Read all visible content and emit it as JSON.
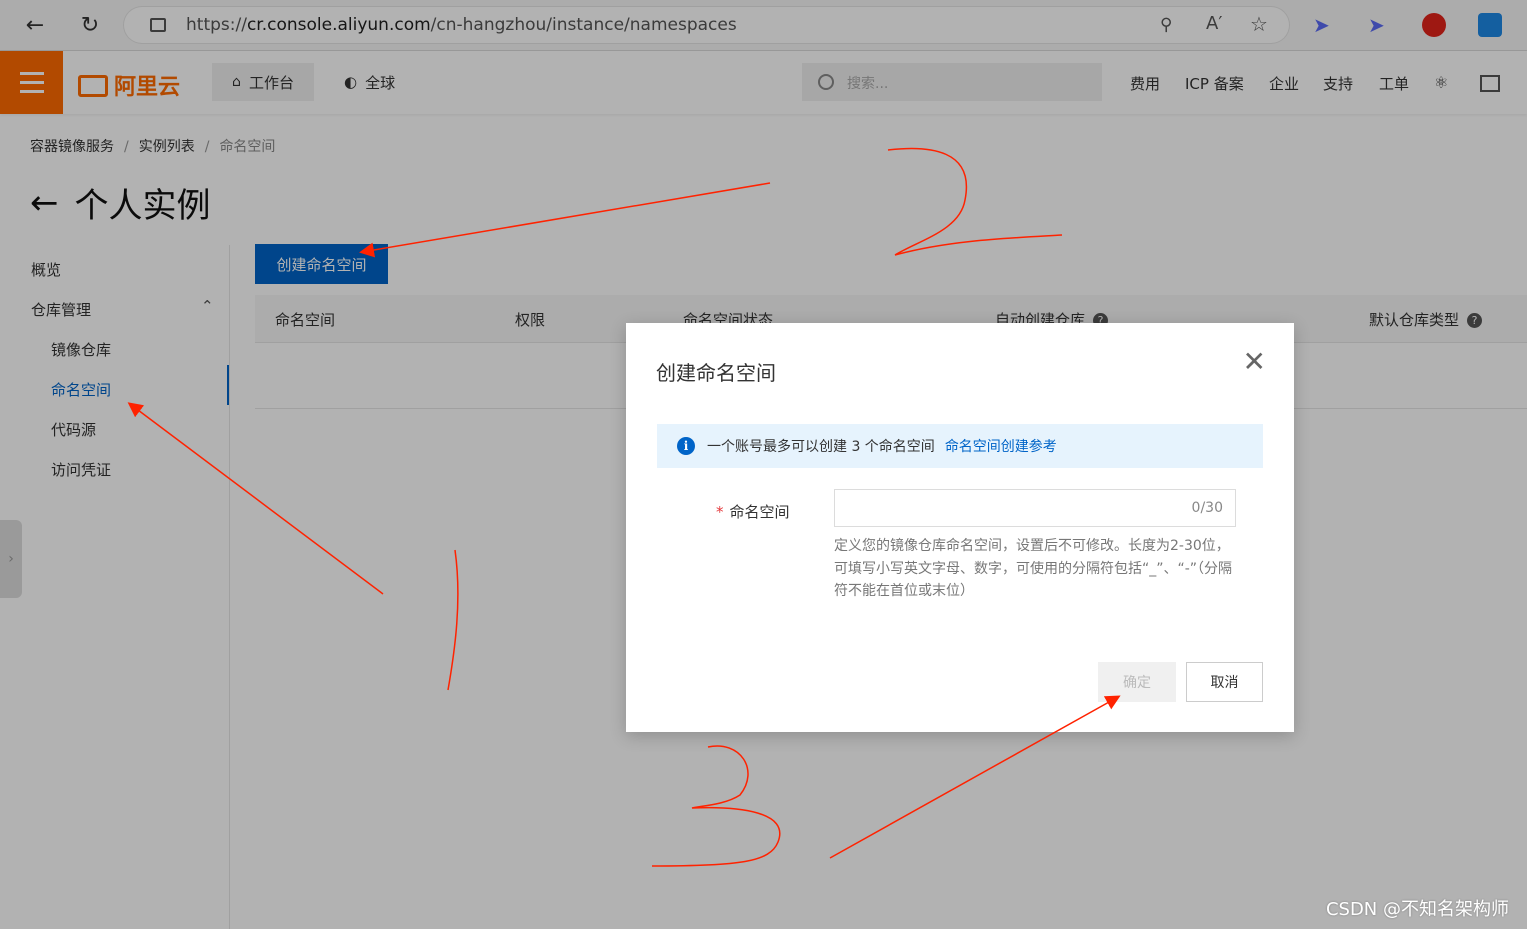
{
  "browser": {
    "url_prefix": "https://",
    "url_host": "cr.console.aliyun.com",
    "url_path": "/cn-hangzhou/instance/namespaces"
  },
  "header": {
    "logo": "阿里云",
    "workbench": "工作台",
    "region": "全球",
    "search_placeholder": "搜索...",
    "links": [
      "费用",
      "ICP 备案",
      "企业",
      "支持",
      "工单"
    ]
  },
  "breadcrumb": [
    "容器镜像服务",
    "实例列表",
    "命名空间"
  ],
  "page_title": "个人实例",
  "sidebar": {
    "overview": "概览",
    "repo_mgmt": "仓库管理",
    "items": [
      "镜像仓库",
      "命名空间",
      "代码源",
      "访问凭证"
    ]
  },
  "main": {
    "create_button": "创建命名空间",
    "columns": [
      "命名空间",
      "权限",
      "命名空间状态",
      "自动创建仓库",
      "默认仓库类型"
    ]
  },
  "dialog": {
    "title": "创建命名空间",
    "notice": "一个账号最多可以创建 3 个命名空间",
    "notice_link": "命名空间创建参考",
    "field_label": "命名空间",
    "counter": "0/30",
    "hint": "定义您的镜像仓库命名空间，设置后不可修改。长度为2-30位，可填写小写英文字母、数字，可使用的分隔符包括“_”、“-”（分隔符不能在首位或末位）",
    "ok": "确定",
    "cancel": "取消"
  },
  "watermark": "CSDN @不知名架构师",
  "colors": {
    "brand": "#ff6a00",
    "primary": "#0064c8",
    "annotation": "#ff2200"
  }
}
